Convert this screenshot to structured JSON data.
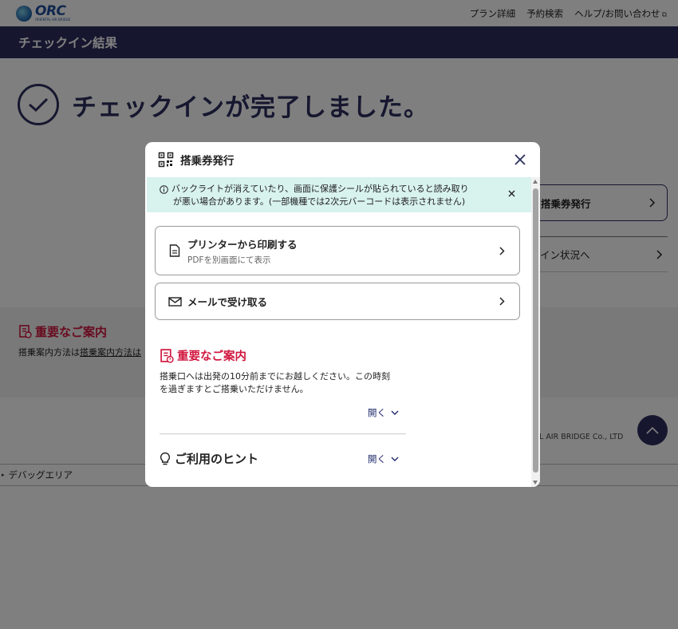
{
  "header": {
    "logo_text": "ORC",
    "logo_sub": "ORIENTAL AIR BRIDGE",
    "nav": [
      "プラン詳細",
      "予約検索",
      "ヘルプ/お問い合わせ"
    ]
  },
  "page": {
    "title": "チェックイン結果",
    "complete_message": "チェックインが完了しました。",
    "boarding_pass_button": "搭乗券発行",
    "checkin_status_link": "イン状況へ",
    "important_heading": "重要なご案内",
    "important_text_prefix": "搭乗案内方法は",
    "important_text_link": "搭乗案内方法は",
    "copyright": "L AIR BRIDGE Co., LTD",
    "debug_label": "デバッグエリア"
  },
  "modal": {
    "title": "搭乗券発行",
    "notice_line1": "バックライトが消えていたり、画面に保護シールが貼られていると読み取り",
    "notice_line2": "が悪い場合があります。(一部機種では2次元バーコードは表示されません)",
    "print_label": "プリンターから印刷する",
    "print_sub": "PDFを別画面にて表示",
    "mail_label": "メールで受け取る",
    "important_title": "重要なご案内",
    "important_line1": "搭乗口へは出発の10分前までにお越しください。この時刻",
    "important_line2": "を過ぎますとご搭乗いただけません。",
    "open_label": "開く",
    "hint_title": "ご利用のヒント"
  },
  "colors": {
    "navy": "#2c2f5e",
    "alert_red": "#d1173f",
    "notice_bg": "#d8f2ee"
  }
}
